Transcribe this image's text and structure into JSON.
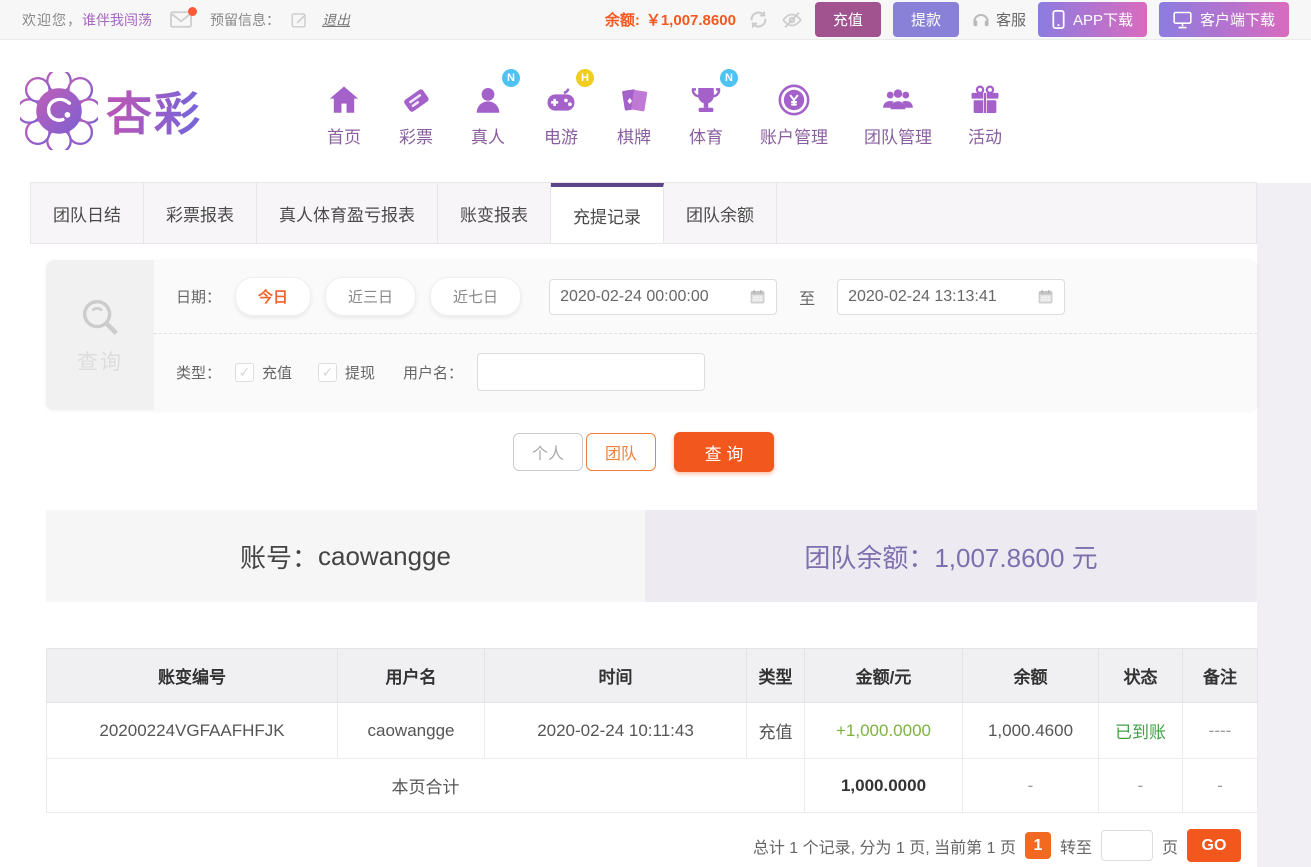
{
  "topbar": {
    "welcome_prefix": "欢迎您，",
    "username": "谁伴我闯荡",
    "reserved_label": "预留信息：",
    "logout_label": "退出",
    "balance_label": "余额:",
    "balance_value": "￥1,007.8600",
    "recharge_label": "充值",
    "withdraw_label": "提款",
    "service_label": "客服",
    "app_download_label": "APP下载",
    "client_download_label": "客户端下载"
  },
  "brand": {
    "name": "杏彩"
  },
  "nav": {
    "items": [
      {
        "label": "首页",
        "icon": "home-icon",
        "badge": ""
      },
      {
        "label": "彩票",
        "icon": "ticket-icon",
        "badge": ""
      },
      {
        "label": "真人",
        "icon": "live-person-icon",
        "badge": "N"
      },
      {
        "label": "电游",
        "icon": "gamepad-icon",
        "badge": "H"
      },
      {
        "label": "棋牌",
        "icon": "cards-icon",
        "badge": ""
      },
      {
        "label": "体育",
        "icon": "trophy-icon",
        "badge": "N"
      },
      {
        "label": "账户管理",
        "icon": "coin-icon",
        "badge": ""
      },
      {
        "label": "团队管理",
        "icon": "team-icon",
        "badge": ""
      },
      {
        "label": "活动",
        "icon": "gift-icon",
        "badge": ""
      }
    ]
  },
  "tabs": {
    "items": [
      {
        "label": "团队日结",
        "active": false
      },
      {
        "label": "彩票报表",
        "active": false
      },
      {
        "label": "真人体育盈亏报表",
        "active": false
      },
      {
        "label": "账变报表",
        "active": false
      },
      {
        "label": "充提记录",
        "active": true
      },
      {
        "label": "团队余额",
        "active": false
      }
    ]
  },
  "filter": {
    "sidebar_label": "查询",
    "date_label": "日期：",
    "presets": [
      {
        "label": "今日",
        "active": true
      },
      {
        "label": "近三日",
        "active": false
      },
      {
        "label": "近七日",
        "active": false
      }
    ],
    "date_from": "2020-02-24 00:00:00",
    "to_label": "至",
    "date_to": "2020-02-24 13:13:41",
    "type_label": "类型：",
    "type_recharge": "充值",
    "type_withdraw": "提现",
    "username_label": "用户名：",
    "username_value": "",
    "personal_label": "个人",
    "team_label": "团队",
    "query_label": "查 询"
  },
  "account": {
    "account_label": "账号：",
    "account_value": "caowangge",
    "balance_label": "团队余额：",
    "balance_value": "1,007.8600 元"
  },
  "table": {
    "headers": [
      "账变编号",
      "用户名",
      "时间",
      "类型",
      "金额/元",
      "余额",
      "状态",
      "备注"
    ],
    "rows": [
      {
        "id": "20200224VGFAAFHFJK",
        "user": "caowangge",
        "time": "2020-02-24 10:11:43",
        "type": "充值",
        "amount": "+1,000.0000",
        "balance": "1,000.4600",
        "status": "已到账",
        "remark": "----"
      }
    ],
    "summary": {
      "label": "本页合计",
      "amount": "1,000.0000",
      "balance": "-",
      "status": "-",
      "remark": "-"
    }
  },
  "pagination": {
    "summary_text": "总计 1 个记录, 分为 1 页, 当前第 1 页",
    "current_page": "1",
    "goto_label": "转至",
    "page_unit": "页",
    "go_label": "GO"
  },
  "colors": {
    "accent_orange": "#f2571d",
    "balance_orange": "#f4581f",
    "brand_purple": "#8a5fa0",
    "tab_active_border": "#5a4589",
    "team_balance_purple": "#7e6fae",
    "positive_green": "#7cb342",
    "status_green": "#43a047",
    "recharge_button": "#a0538f",
    "withdraw_button": "#8981d8"
  }
}
